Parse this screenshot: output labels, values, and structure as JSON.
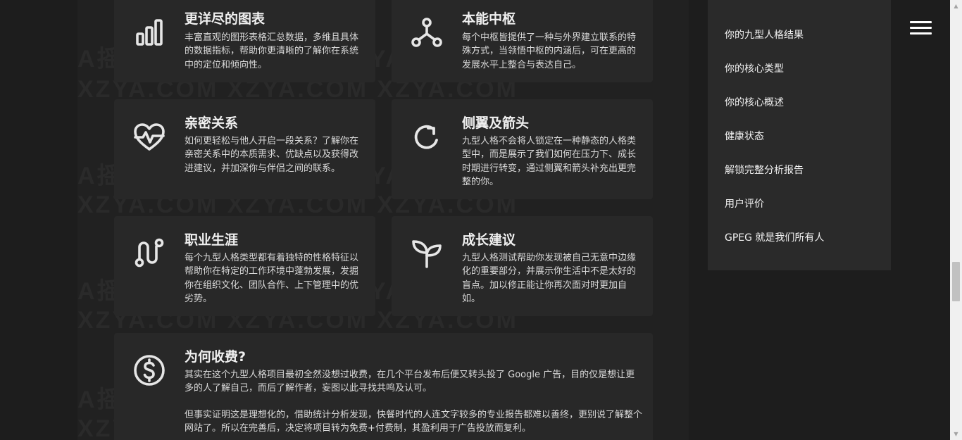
{
  "watermark": {
    "line_a": "A摇  XZYA.COM  A摇  XZYA.COM  A摇  X观",
    "line_b": "XZYA.COM   XZYA.COM   XZYA.COM"
  },
  "cards": [
    {
      "icon": "bar-chart-icon",
      "title": "更详尽的图表",
      "desc": "丰富直观的图形表格汇总数据，多维且具体的数据指标，帮助你更清晰的了解你在系统中的定位和倾向性。"
    },
    {
      "icon": "network-nodes-icon",
      "title": "本能中枢",
      "desc": "每个中枢皆提供了一种与外界建立联系的特殊方式，当领悟中枢的内涵后，可在更高的发展水平上整合与表达自己。"
    },
    {
      "icon": "heart-pulse-icon",
      "title": "亲密关系",
      "desc": "如何更轻松与他人开启一段关系？了解你在亲密关系中的本质需求、优缺点以及获得改进建议，并加深你与伴侣之间的联系。"
    },
    {
      "icon": "rotate-arrow-icon",
      "title": "侧翼及箭头",
      "desc": "九型人格不会将人锁定在一种静态的人格类型中，而是展示了我们如何在压力下、成长时期进行转变，通过侧翼和箭头补充出更完整的你。"
    },
    {
      "icon": "route-path-icon",
      "title": "职业生涯",
      "desc": "每个九型人格类型都有着独特的性格特征以帮助你在特定的工作环境中蓬勃发展，发掘你在组织文化、团队合作、上下管理中的优劣势。"
    },
    {
      "icon": "sprout-icon",
      "title": "成长建议",
      "desc": "九型人格测试帮助你发现被自己无意中边缘化的重要部分，并展示你生活中不是太好的盲点。加以修正能让你再次面对时更加自如。"
    }
  ],
  "wide_card": {
    "icon": "dollar-coin-icon",
    "title": "为何收费?",
    "para1": "其实在这个九型人格项目最初全然没想过收费，在几个平台发布后便又转头投了 Google 广告，目的仅是想让更多的人了解自己，而后了解作者，妄图以此寻找共鸣及认可。",
    "para2": "但事实证明这是理想化的，借助统计分析发现，快餐时代的人连文字较多的专业报告都难以善终，更别说了解整个网站了。所以在完善后，决定将项目转为免费+付费制，其盈利用于广告投放而复利。"
  },
  "sidebar": {
    "items": [
      "你的九型人格结果",
      "你的核心类型",
      "你的核心概述",
      "健康状态",
      "解锁完整分析报告",
      "用户评价",
      "GPEG 就是我们所有人"
    ]
  },
  "scrollbar": {
    "up_arrow": "▲",
    "down_arrow": "▼"
  }
}
